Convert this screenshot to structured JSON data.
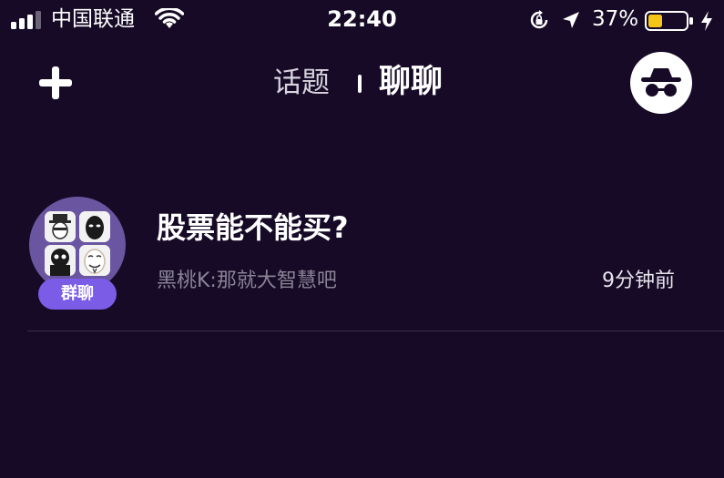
{
  "status_bar": {
    "carrier": "中国联通",
    "time": "22:40",
    "battery_percent": "37%",
    "battery_level": 0.37,
    "battery_color": "#f5c518"
  },
  "nav": {
    "tabs": [
      {
        "label": "话题",
        "active": false
      },
      {
        "label": "聊聊",
        "active": true
      }
    ],
    "icons": {
      "add": "plus-icon",
      "profile": "incognito-icon"
    }
  },
  "chats": [
    {
      "title": "股票能不能买?",
      "badge": "群聊",
      "preview": "黑桃K:那就大智慧吧",
      "time": "9分钟前"
    }
  ],
  "colors": {
    "background": "#160a26",
    "accent": "#7a5ce6",
    "avatar_bg": "#6a55a0",
    "muted_text": "#8a8496"
  }
}
